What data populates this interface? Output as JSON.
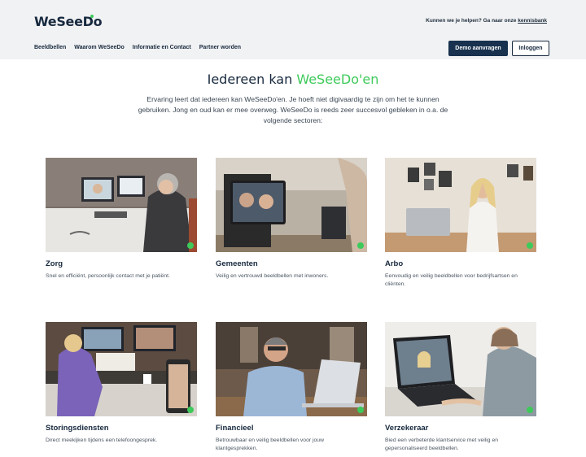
{
  "header": {
    "logo": "WeSeeDo",
    "help_text": "Kunnen we je helpen? Ga naar onze",
    "help_link": "kennisbank",
    "nav": [
      "Beeldbellen",
      "Waarom WeSeeDo",
      "Informatie en Contact",
      "Partner worden"
    ],
    "demo_button": "Demo aanvragen",
    "login_button": "Inloggen"
  },
  "hero": {
    "headline_prefix": "Iedereen kan ",
    "headline_accent": "WeSeeDo'en",
    "intro": "Ervaring leert dat iedereen kan WeSeeDo'en. Je hoeft niet digivaardig te zijn om het te kunnen gebruiken. Jong en oud kan er mee overweg. WeSeeDo is reeds zeer succesvol gebleken in o.a. de volgende sectoren:"
  },
  "sectors": [
    {
      "title": "Zorg",
      "description": "Snel en efficiënt, persoonlijk contact met je patiënt."
    },
    {
      "title": "Gemeenten",
      "description": "Veilig en vertrouwd beeldbellen met inwoners."
    },
    {
      "title": "Arbo",
      "description": "Eenvoudig en veilig beeldbellen voor bedrijfsartsen en cliënten."
    },
    {
      "title": "Storingsdiensten",
      "description": "Direct meekijken tijdens een telefoongesprek."
    },
    {
      "title": "Financieel",
      "description": "Betrouwbaar en veilig beeldbellen voor jouw klantgesprekken."
    },
    {
      "title": "Verzekeraar",
      "description": "Bied een verbeterde klantservice met veilig en gepersonaliseerd beeldbellen."
    }
  ],
  "colors": {
    "accent": "#3dca5a",
    "navy": "#17314e",
    "header_bg": "#f1f2f4"
  }
}
